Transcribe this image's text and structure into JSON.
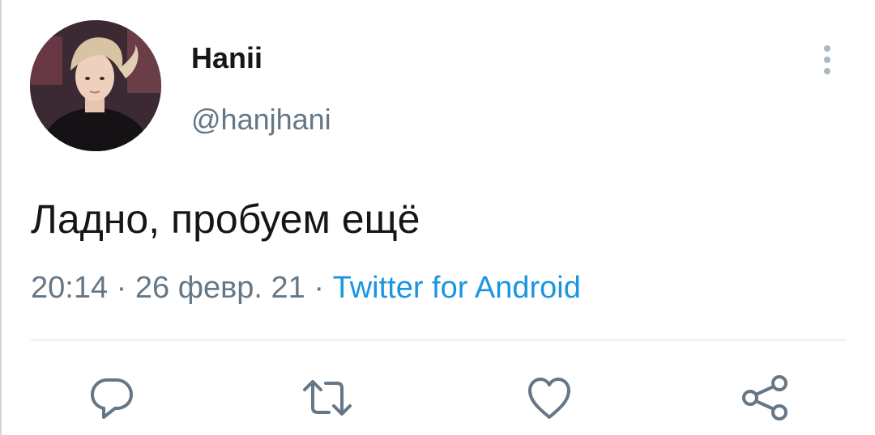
{
  "user": {
    "display_name": "Hanii",
    "handle": "@hanjhani"
  },
  "tweet": {
    "text": "Ладно, пробуем ещё",
    "time": "20:14",
    "separator": " · ",
    "date": "26 февр. 21",
    "source": "Twitter for Android"
  },
  "actions": [
    {
      "name": "reply",
      "icon": "reply-icon"
    },
    {
      "name": "retweet",
      "icon": "retweet-icon"
    },
    {
      "name": "like",
      "icon": "heart-icon"
    },
    {
      "name": "share",
      "icon": "share-icon"
    }
  ],
  "colors": {
    "text": "#14171a",
    "secondary": "#657786",
    "link": "#1b95e0",
    "icon": "#657786"
  }
}
